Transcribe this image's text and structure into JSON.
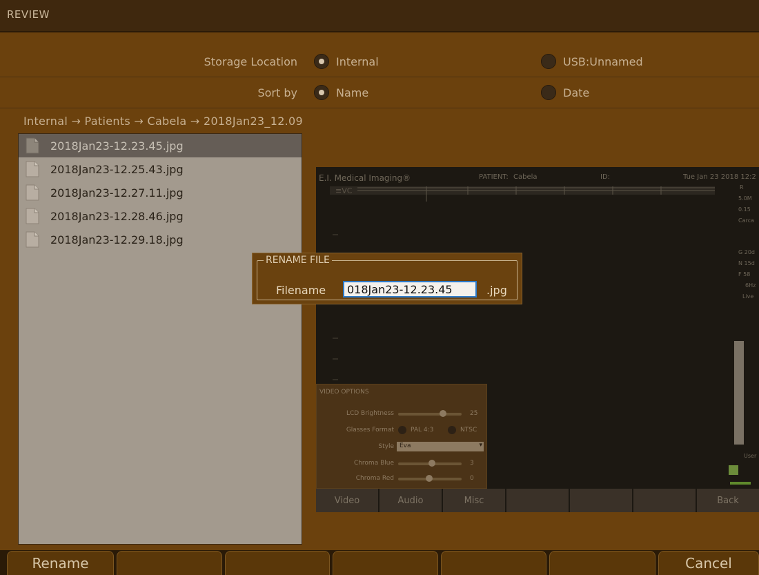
{
  "window": {
    "title": "REVIEW"
  },
  "storage": {
    "label": "Storage Location",
    "options": [
      "Internal",
      "USB:Unnamed"
    ],
    "selected": "Internal"
  },
  "sort": {
    "label": "Sort by",
    "options": [
      "Name",
      "Date"
    ],
    "selected": "Name"
  },
  "breadcrumb": "Internal → Patients → Cabela → 2018Jan23_12.09",
  "files": [
    "2018Jan23-12.23.45.jpg",
    "2018Jan23-12.25.43.jpg",
    "2018Jan23-12.27.11.jpg",
    "2018Jan23-12.28.46.jpg",
    "2018Jan23-12.29.18.jpg"
  ],
  "selected_file": "2018Jan23-12.23.45.jpg",
  "preview": {
    "brand": "E.I. Medical Imaging®",
    "patient_label": "PATIENT:",
    "patient_value": "Cabela",
    "id_label": "ID:",
    "datetime": "Tue Jan 23 2018 12:2",
    "side_texts": [
      "R",
      "5.0M",
      "0.15",
      "Carca",
      "G 20d",
      "N 15d",
      "F 58",
      "6Hz",
      "Live",
      "User"
    ],
    "video_options": {
      "title": "VIDEO OPTIONS",
      "lcd_brightness_label": "LCD Brightness",
      "lcd_brightness_value": "25",
      "glasses_format_label": "Glasses Format",
      "glasses_options": [
        "PAL 4:3",
        "NTSC"
      ],
      "style_label": "Style",
      "style_value": "Eva",
      "chroma_blue_label": "Chroma Blue",
      "chroma_blue_value": "3",
      "chroma_red_label": "Chroma Red",
      "chroma_red_value": "0"
    },
    "tabs": [
      "Video",
      "Audio",
      "Misc",
      "",
      "",
      "",
      "Back"
    ]
  },
  "rename_dialog": {
    "title": "RENAME FILE",
    "filename_label": "Filename",
    "filename_value": "018Jan23-12.23.45",
    "extension": ".jpg"
  },
  "bottom_buttons": [
    "Rename",
    "",
    "",
    "",
    "",
    "",
    "Cancel"
  ],
  "colors": {
    "background": "#6b410d",
    "titlebar": "#3f280e",
    "list_bg": "#a39a8e",
    "list_selected": "#655d56",
    "input_border": "#2c79c8",
    "button": "#5a3709"
  }
}
